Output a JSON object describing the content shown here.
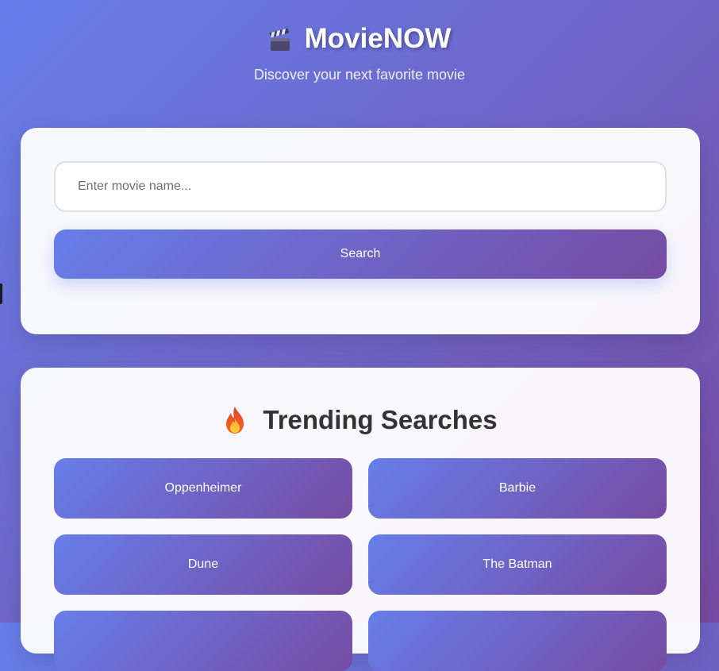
{
  "header": {
    "title": "MovieNOW",
    "subtitle": "Discover your next favorite movie",
    "icon": "clapperboard-icon"
  },
  "search": {
    "placeholder": "Enter movie name...",
    "value": "",
    "button_label": "Search"
  },
  "trending": {
    "icon": "fire-icon",
    "title": "Trending Searches",
    "items": [
      {
        "label": "Oppenheimer"
      },
      {
        "label": "Barbie"
      },
      {
        "label": "Dune"
      },
      {
        "label": "The Batman"
      },
      {
        "label": ""
      },
      {
        "label": ""
      }
    ]
  },
  "colors": {
    "gradient_start": "#667eea",
    "gradient_end": "#764ba2",
    "card_background": "#f7f6fb",
    "heading_text": "#333333"
  }
}
